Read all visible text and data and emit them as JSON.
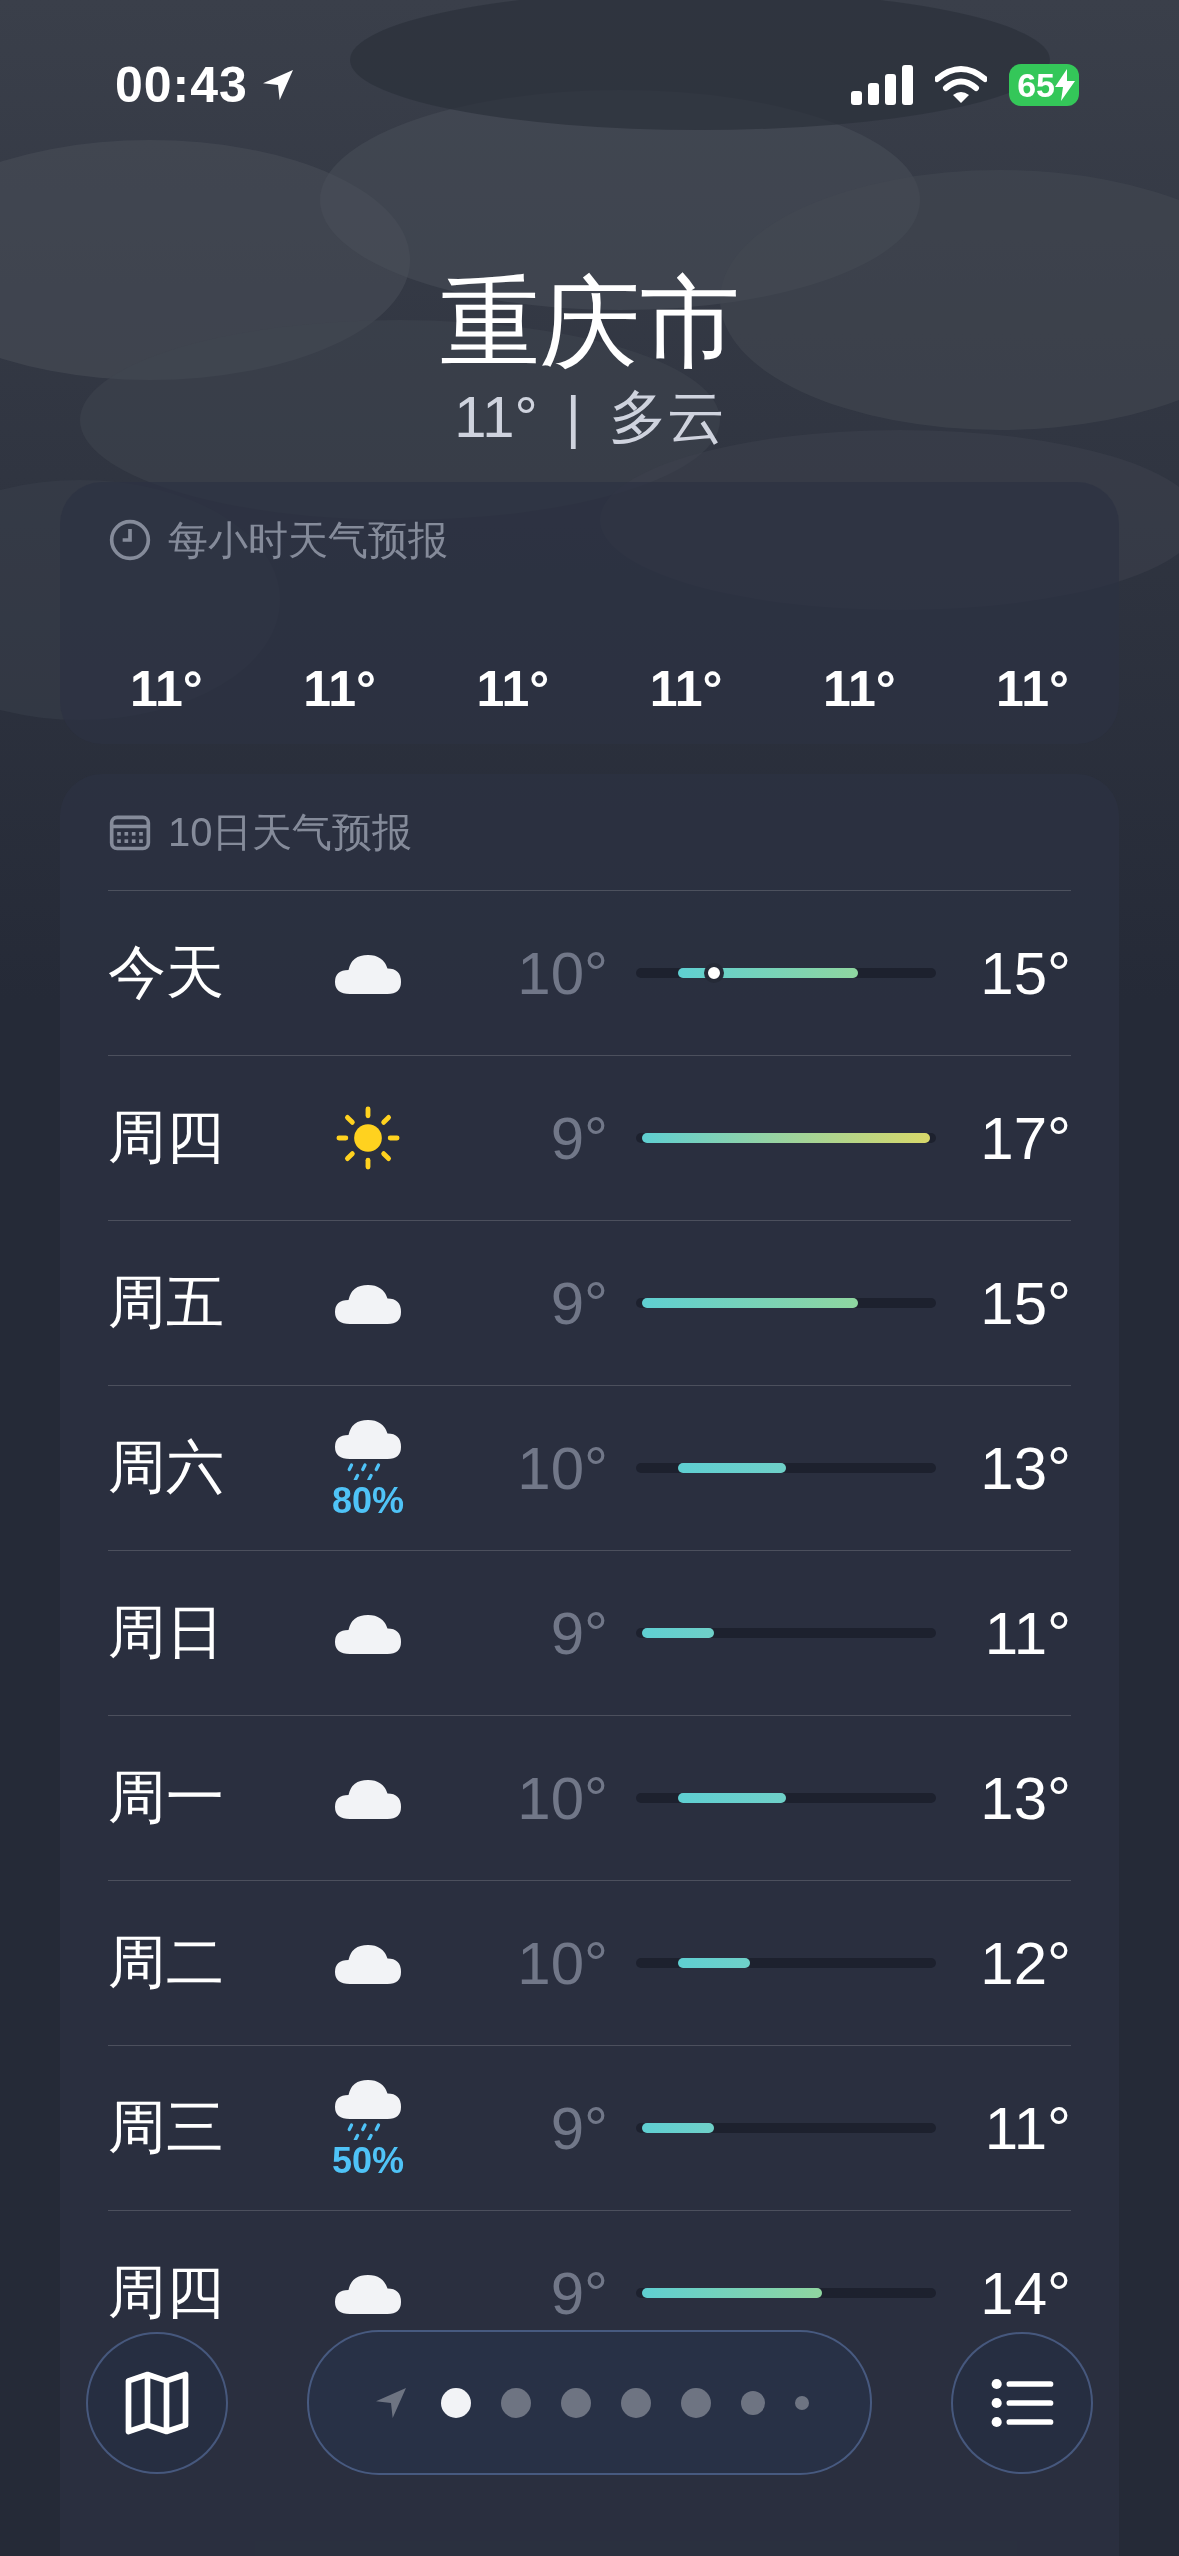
{
  "status_bar": {
    "time": "00:43",
    "battery": "65",
    "location_active": true
  },
  "header": {
    "city": "重庆市",
    "temperature": "11°",
    "separator": "|",
    "condition": "多云"
  },
  "hourly": {
    "title": "每小时天气预报",
    "temps": [
      "11°",
      "11°",
      "11°",
      "11°",
      "11°",
      "11°"
    ]
  },
  "daily": {
    "title": "10日天气预报",
    "days": [
      {
        "day": "今天",
        "kind": "cloud",
        "low": "10°",
        "high": "15°",
        "now_marker": true
      },
      {
        "day": "周四",
        "kind": "sun",
        "low": "9°",
        "high": "17°",
        "now_marker": false
      },
      {
        "day": "周五",
        "kind": "cloud",
        "low": "9°",
        "high": "15°",
        "now_marker": false
      },
      {
        "day": "周六",
        "kind": "rain",
        "precip": "80%",
        "low": "10°",
        "high": "13°",
        "now_marker": false
      },
      {
        "day": "周日",
        "kind": "cloud",
        "low": "9°",
        "high": "11°",
        "now_marker": false
      },
      {
        "day": "周一",
        "kind": "cloud",
        "low": "10°",
        "high": "13°",
        "now_marker": false
      },
      {
        "day": "周二",
        "kind": "cloud",
        "low": "10°",
        "high": "12°",
        "now_marker": false
      },
      {
        "day": "周三",
        "kind": "rain",
        "precip": "50%",
        "low": "9°",
        "high": "11°",
        "now_marker": false
      },
      {
        "day": "周四",
        "kind": "cloud",
        "low": "9°",
        "high": "14°",
        "now_marker": false
      }
    ]
  },
  "pager": [
    {
      "kind": "location",
      "selected": false
    },
    {
      "kind": "dot",
      "selected": true
    },
    {
      "kind": "dot",
      "selected": false
    },
    {
      "kind": "dot",
      "selected": false
    },
    {
      "kind": "dot",
      "selected": false
    },
    {
      "kind": "dot",
      "selected": false
    },
    {
      "kind": "small",
      "selected": false
    },
    {
      "kind": "tiny",
      "selected": false
    }
  ]
}
